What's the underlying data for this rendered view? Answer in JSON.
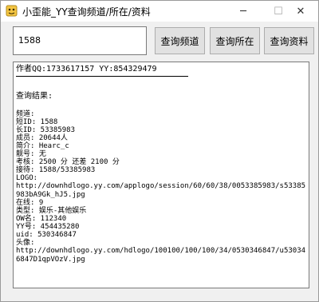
{
  "window": {
    "title": "小歪能_YY查询频道/所在/资料",
    "minimize_label": "─",
    "maximize_label": "☐",
    "close_label": "✕"
  },
  "query": {
    "value": "1588"
  },
  "buttons": {
    "channel": "查询频道",
    "location": "查询所在",
    "profile": "查询资料"
  },
  "result": {
    "author": "作者QQ:1733617157  YY:854329479",
    "header": "查询结果:",
    "lines": [
      "频道:",
      "短ID: 1588",
      "长ID: 53385983",
      "成员: 20644人",
      "简介: Hearc_c",
      "靓号: 无",
      "考核: 2500 分  还差 2100 分",
      "接待: 1588/53385983",
      "LOGO:"
    ],
    "logo_url": "http://downhdlogo.yy.com/applogo/session/60/60/38/0053385983/s53385983bA9Gk_hJ5.jpg",
    "lines2": [
      "在线: 9",
      "类型: 娱乐-其他娱乐",
      "OW名: 112340",
      "YY号: 454435280",
      " uid: 530346847",
      "头像:"
    ],
    "avatar_url": "http://downhdlogo.yy.com/hdlogo/100100/100/100/34/0530346847/u530346847D1qpVOzV.jpg"
  }
}
